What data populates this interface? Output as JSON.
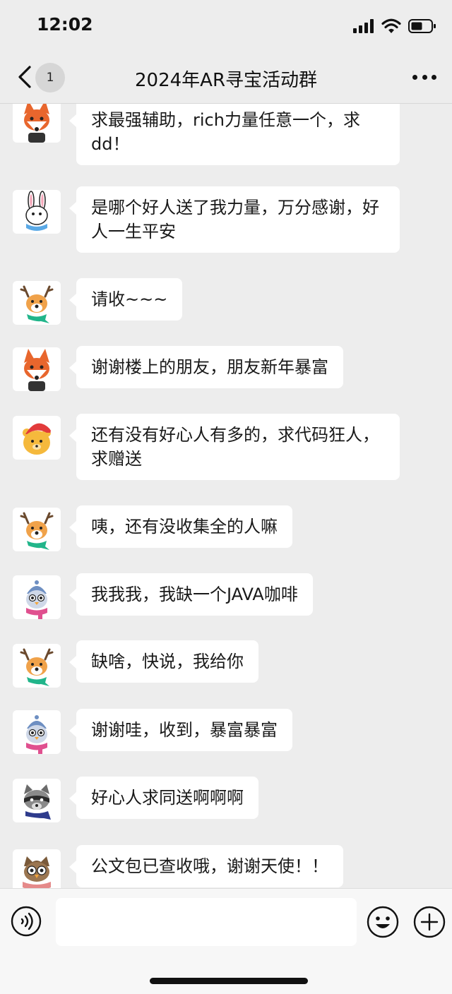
{
  "status": {
    "time": "12:02"
  },
  "header": {
    "unread_count": "1",
    "title": "2024年AR寻宝活动群"
  },
  "messages": [
    {
      "avatar": "fox-avatar",
      "text": "求最强辅助，rich力量任意一个，求dd！"
    },
    {
      "avatar": "rabbit-avatar",
      "text": "是哪个好人送了我力量，万分感谢，好人一生平安"
    },
    {
      "avatar": "deer-avatar",
      "text": "请收~~~"
    },
    {
      "avatar": "fox-avatar",
      "text": "谢谢楼上的朋友，朋友新年暴富"
    },
    {
      "avatar": "bear-santa-avatar",
      "text": "还有没有好心人有多的，求代码狂人，求赠送"
    },
    {
      "avatar": "deer-avatar",
      "text": "咦，还有没收集全的人嘛"
    },
    {
      "avatar": "penguin-avatar",
      "text": "我我我，我缺一个JAVA咖啡"
    },
    {
      "avatar": "deer-avatar",
      "text": "缺啥，快说，我给你"
    },
    {
      "avatar": "penguin-avatar",
      "text": "谢谢哇，收到，暴富暴富"
    },
    {
      "avatar": "raccoon-avatar",
      "text": "好心人求同送啊啊啊"
    },
    {
      "avatar": "owl-avatar",
      "text": "公文包已查收哦，谢谢天使！！"
    }
  ],
  "input": {
    "value": ""
  },
  "icons": {
    "back": "chevron-left-icon",
    "more": "more-dots-icon",
    "voice": "voice-icon",
    "emoji": "emoji-icon",
    "plus": "plus-icon"
  }
}
